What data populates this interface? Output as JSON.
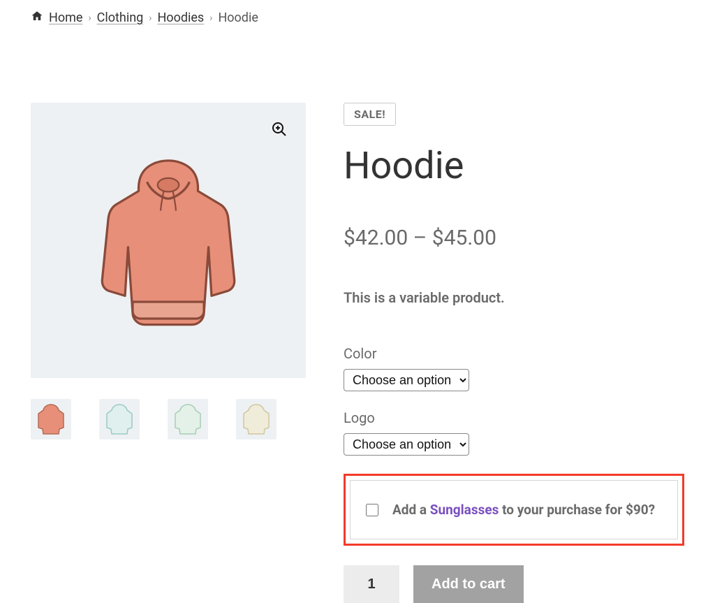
{
  "breadcrumb": {
    "home": "Home",
    "clothing": "Clothing",
    "hoodies": "Hoodies",
    "current": "Hoodie"
  },
  "sale_badge": "SALE!",
  "product_title": "Hoodie",
  "price_text": "$42.00 – $45.00",
  "description": "This is a variable product.",
  "variations": {
    "color": {
      "label": "Color",
      "placeholder": "Choose an option"
    },
    "logo": {
      "label": "Logo",
      "placeholder": "Choose an option"
    }
  },
  "upsell": {
    "prefix": "Add a ",
    "product": "Sunglasses",
    "suffix": " to your purchase for $90?"
  },
  "quantity": "1",
  "add_to_cart": "Add to cart",
  "thumb_colors": [
    "#e78f79",
    "#c7e6e3",
    "#cfe7db",
    "#e6e0c7"
  ]
}
